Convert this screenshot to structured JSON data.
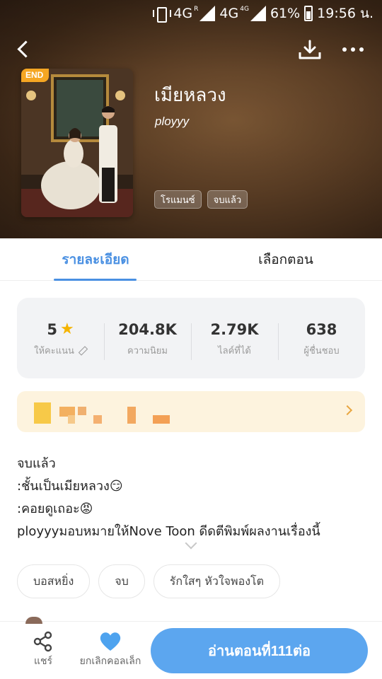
{
  "status_bar": {
    "network_1": "4G",
    "network_1_tag": "R",
    "network_2": "4G",
    "network_2_tag": "4G",
    "battery": "61%",
    "time": "19:56 น."
  },
  "book": {
    "end_badge": "END",
    "title": "เมียหลวง",
    "author": "ployyy",
    "tags": [
      "โรแมนซ์",
      "จบแล้ว"
    ]
  },
  "tabs": {
    "detail": "รายละเอียด",
    "episodes": "เลือกตอน"
  },
  "stats": [
    {
      "value": "5",
      "label": "ให้คะแนน"
    },
    {
      "value": "204.8K",
      "label": "ความนิยม"
    },
    {
      "value": "2.79K",
      "label": "ไลค์ที่ได้"
    },
    {
      "value": "638",
      "label": "ผู้ชื่นชอบ"
    }
  ],
  "description": {
    "lines": [
      "จบแล้ว",
      ":ชั้นเป็นเมียหลวง😏",
      ":คอยดูเถอะ😡",
      "ployyyมอบหมายให้Nove Toon ดีดตีพิมพ์ผลงานเรื่องนี้"
    ]
  },
  "keyword_chips": [
    "บอสหยิ่ง",
    "จบ",
    "รักใสๆ หัวใจพองโต"
  ],
  "bottom_bar": {
    "share_label": "แชร์",
    "unfollow_label": "ยกเลิกคอลเล็ก",
    "read_button": "อ่านตอนที่111ต่อ"
  },
  "icons": {
    "back": "chevron-left-icon",
    "download": "download-icon",
    "more": "more-dots-icon",
    "star": "star-icon",
    "pen": "pen-icon",
    "share": "share-icon",
    "heart": "heart-icon"
  },
  "colors": {
    "accent": "#4a90e2",
    "read_button": "#5ca6ef",
    "star": "#f5b400",
    "end_badge": "#f5a623",
    "fans_banner": "#fdf3de"
  }
}
